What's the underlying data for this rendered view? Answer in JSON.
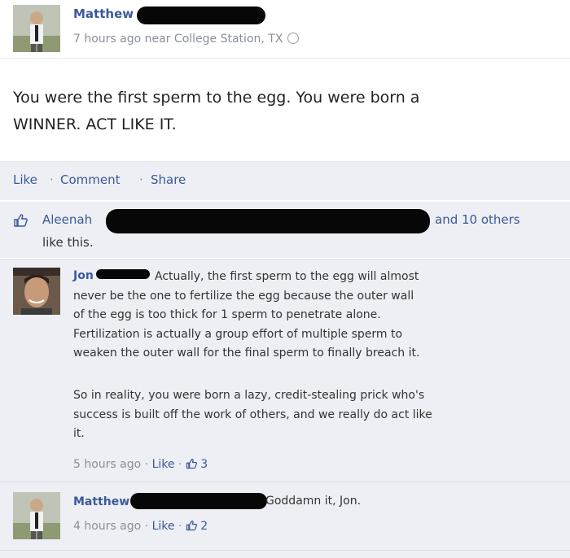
{
  "post": {
    "author": "Matthew",
    "meta": "7 hours ago near College Station, TX",
    "status_line1": "You were the first sperm to the egg. You were born a",
    "status_line2": "WINNER. ACT LIKE IT."
  },
  "actions": {
    "like": "Like",
    "comment": "Comment",
    "share": "Share",
    "separator": "·"
  },
  "likes": {
    "name": "Aleenah",
    "others": "and 10 others",
    "suffix": "like this."
  },
  "comments": [
    {
      "author": "Jon",
      "lines": [
        "Actually, the first sperm to the egg will almost",
        "never be the one to fertilize the egg because the outer wall",
        "of the egg is too thick for 1 sperm to penetrate alone.",
        "Fertilization is actually a group effort of multiple sperm to",
        "weaken the outer wall for the final sperm to finally breach it.",
        "",
        "So in reality, you were born a lazy, credit-stealing prick who's",
        "success is built off the work of others, and we really do act like",
        "it."
      ],
      "time": "5 hours ago",
      "like_label": "Like",
      "like_count": "3"
    },
    {
      "author": "Matthew",
      "text": "Goddamn it, Jon.",
      "time": "4 hours ago",
      "like_label": "Like",
      "like_count": "2"
    }
  ],
  "icons": {
    "globe": "globe-icon",
    "thumb": "thumbs-up-icon"
  },
  "colors": {
    "link": "#3b5998",
    "meta": "#8a8f99",
    "panel": "#edeff4"
  }
}
